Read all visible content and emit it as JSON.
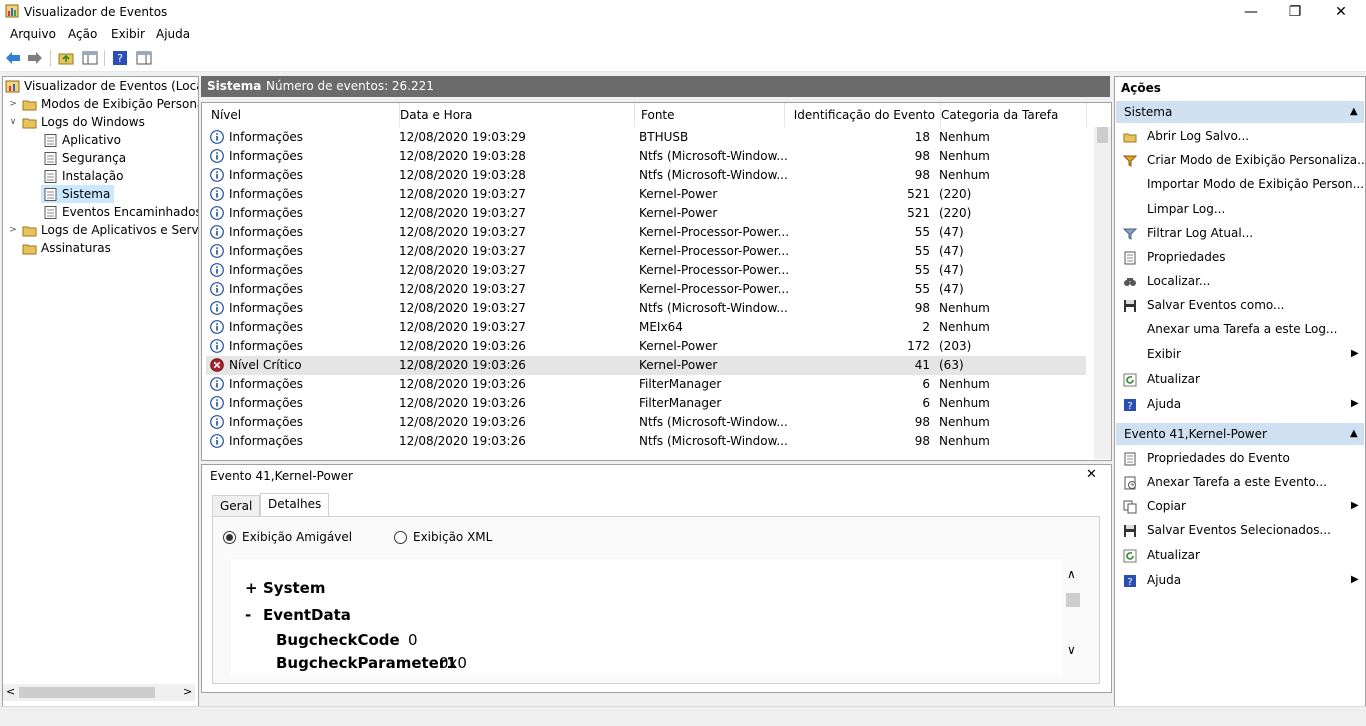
{
  "window": {
    "title": "Visualizador de Eventos",
    "minimize": "—",
    "maximize": "❐",
    "close": "✕"
  },
  "menu": [
    "Arquivo",
    "Ação",
    "Exibir",
    "Ajuda"
  ],
  "tree": {
    "root": "Visualizador de Eventos (Local)",
    "custom_views": "Modos de Exibição Personali",
    "windows_logs": "Logs do Windows",
    "application": "Aplicativo",
    "security": "Segurança",
    "setup": "Instalação",
    "system": "Sistema",
    "forwarded": "Eventos Encaminhados",
    "apps_services": "Logs de Aplicativos e Serviço",
    "subscriptions": "Assinaturas"
  },
  "center": {
    "title": "Sistema",
    "count_label": "Número de eventos: 26.221"
  },
  "columns": [
    "Nível",
    "Data e Hora",
    "Fonte",
    "Identificação do Evento",
    "Categoria da Tarefa"
  ],
  "rows": [
    {
      "level": "Informações",
      "date": "12/08/2020 19:03:29",
      "source": "BTHUSB",
      "id": "18",
      "cat": "Nenhum"
    },
    {
      "level": "Informações",
      "date": "12/08/2020 19:03:28",
      "source": "Ntfs (Microsoft-Window...",
      "id": "98",
      "cat": "Nenhum"
    },
    {
      "level": "Informações",
      "date": "12/08/2020 19:03:28",
      "source": "Ntfs (Microsoft-Window...",
      "id": "98",
      "cat": "Nenhum"
    },
    {
      "level": "Informações",
      "date": "12/08/2020 19:03:27",
      "source": "Kernel-Power",
      "id": "521",
      "cat": "(220)"
    },
    {
      "level": "Informações",
      "date": "12/08/2020 19:03:27",
      "source": "Kernel-Power",
      "id": "521",
      "cat": "(220)"
    },
    {
      "level": "Informações",
      "date": "12/08/2020 19:03:27",
      "source": "Kernel-Processor-Power...",
      "id": "55",
      "cat": "(47)"
    },
    {
      "level": "Informações",
      "date": "12/08/2020 19:03:27",
      "source": "Kernel-Processor-Power...",
      "id": "55",
      "cat": "(47)"
    },
    {
      "level": "Informações",
      "date": "12/08/2020 19:03:27",
      "source": "Kernel-Processor-Power...",
      "id": "55",
      "cat": "(47)"
    },
    {
      "level": "Informações",
      "date": "12/08/2020 19:03:27",
      "source": "Kernel-Processor-Power...",
      "id": "55",
      "cat": "(47)"
    },
    {
      "level": "Informações",
      "date": "12/08/2020 19:03:27",
      "source": "Ntfs (Microsoft-Window...",
      "id": "98",
      "cat": "Nenhum"
    },
    {
      "level": "Informações",
      "date": "12/08/2020 19:03:27",
      "source": "MEIx64",
      "id": "2",
      "cat": "Nenhum"
    },
    {
      "level": "Informações",
      "date": "12/08/2020 19:03:26",
      "source": "Kernel-Power",
      "id": "172",
      "cat": "(203)"
    },
    {
      "level": "Nível Crítico",
      "date": "12/08/2020 19:03:26",
      "source": "Kernel-Power",
      "id": "41",
      "cat": "(63)",
      "critical": true
    },
    {
      "level": "Informações",
      "date": "12/08/2020 19:03:26",
      "source": "FilterManager",
      "id": "6",
      "cat": "Nenhum"
    },
    {
      "level": "Informações",
      "date": "12/08/2020 19:03:26",
      "source": "FilterManager",
      "id": "6",
      "cat": "Nenhum"
    },
    {
      "level": "Informações",
      "date": "12/08/2020 19:03:26",
      "source": "Ntfs (Microsoft-Window...",
      "id": "98",
      "cat": "Nenhum"
    },
    {
      "level": "Informações",
      "date": "12/08/2020 19:03:26",
      "source": "Ntfs (Microsoft-Window...",
      "id": "98",
      "cat": "Nenhum"
    }
  ],
  "details": {
    "title": "Evento 41,Kernel-Power",
    "close": "✕",
    "tab_general": "Geral",
    "tab_details": "Detalhes",
    "friendly_view": "Exibição Amigável",
    "xml_view": "Exibição XML",
    "system_toggle": "+",
    "system_label": "System",
    "eventdata_toggle": "-",
    "eventdata_label": "EventData",
    "field1_name": "BugcheckCode",
    "field1_value": "0",
    "field2_name": "BugcheckParameter1",
    "field2_value": "0x0"
  },
  "actions": {
    "header": "Ações",
    "section1": "Sistema",
    "items1": [
      "Abrir Log Salvo...",
      "Criar Modo de Exibição Personaliza...",
      "Importar Modo de Exibição Person...",
      "Limpar Log...",
      "Filtrar Log Atual...",
      "Propriedades",
      "Localizar...",
      "Salvar Eventos como...",
      "Anexar uma Tarefa a este Log...",
      "Exibir",
      "Atualizar",
      "Ajuda"
    ],
    "section2": "Evento 41,Kernel-Power",
    "items2": [
      "Propriedades do Evento",
      "Anexar Tarefa a este Evento...",
      "Copiar",
      "Salvar Eventos Selecionados...",
      "Atualizar",
      "Ajuda"
    ],
    "submenu_arrow": "▶",
    "collapse_arrow": "▲"
  }
}
